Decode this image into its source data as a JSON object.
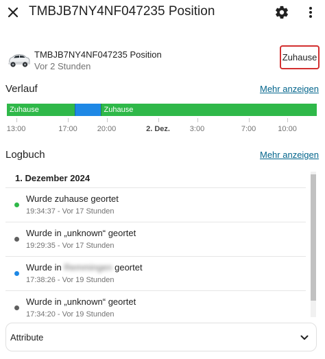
{
  "header": {
    "title": "TMBJB7NY4NF047235 Position"
  },
  "entity": {
    "name": "TMBJB7NY4NF047235 Position",
    "last_changed": "Vor 2 Stunden",
    "state": "Zuhause"
  },
  "history": {
    "title": "Verlauf",
    "more_label": "Mehr anzeigen",
    "segments": [
      {
        "label": "Zuhause",
        "start": 0.0,
        "end": 0.22,
        "color": "#2fb849"
      },
      {
        "label": "",
        "start": 0.22,
        "end": 0.302,
        "color": "#1e88e5"
      },
      {
        "label": "Zuhause",
        "start": 0.302,
        "end": 1.0,
        "color": "#2fb849"
      }
    ],
    "ticks": [
      {
        "label": "13:00",
        "pos": 0.03,
        "bold": false
      },
      {
        "label": "17:00",
        "pos": 0.197,
        "bold": false
      },
      {
        "label": "20:00",
        "pos": 0.322,
        "bold": false
      },
      {
        "label": "2. Dez.",
        "pos": 0.488,
        "bold": true
      },
      {
        "label": "3:00",
        "pos": 0.614,
        "bold": false
      },
      {
        "label": "7:00",
        "pos": 0.78,
        "bold": false
      },
      {
        "label": "10:00",
        "pos": 0.905,
        "bold": false
      }
    ]
  },
  "logbook": {
    "title": "Logbuch",
    "more_label": "Mehr anzeigen",
    "date_header": "1. Dezember 2024",
    "entries": [
      {
        "msg_pre": "Wurde zuhause geortet",
        "msg_blur": "",
        "msg_post": "",
        "time": "19:34:37 - Vor 17 Stunden",
        "color": "#2fb849"
      },
      {
        "msg_pre": "Wurde in „unknown“ geortet",
        "msg_blur": "",
        "msg_post": "",
        "time": "19:29:35 - Vor 17 Stunden",
        "color": "#5f5f5f"
      },
      {
        "msg_pre": "Wurde in ",
        "msg_blur": "Remmingen",
        "msg_post": " geortet",
        "time": "17:38:26 - Vor 19 Stunden",
        "color": "#1e88e5"
      },
      {
        "msg_pre": "Wurde in „unknown“ geortet",
        "msg_blur": "",
        "msg_post": "",
        "time": "17:34:20 - Vor 19 Stunden",
        "color": "#5f5f5f"
      }
    ]
  },
  "attributes": {
    "label": "Attribute"
  },
  "icons": {
    "close": "close-icon",
    "settings": "gear-icon",
    "more": "dots-vertical-icon",
    "entity": "car-icon",
    "expand": "chevron-down-icon"
  }
}
